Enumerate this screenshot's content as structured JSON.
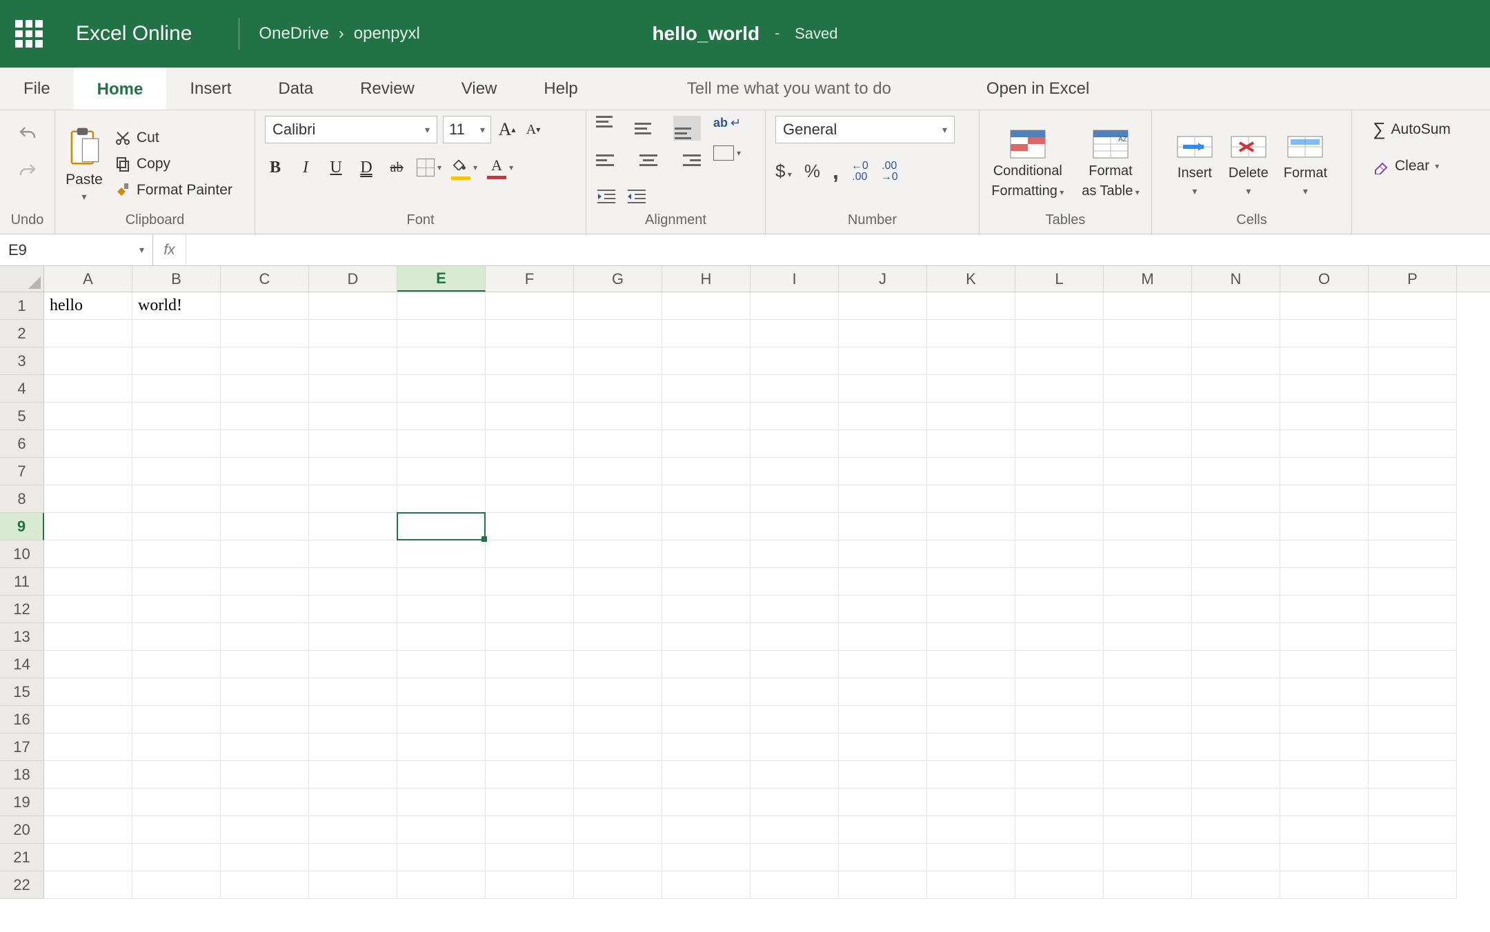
{
  "header": {
    "app_name": "Excel Online",
    "breadcrumb": [
      "OneDrive",
      "openpyxl"
    ],
    "doc_name": "hello_world",
    "doc_status": "Saved"
  },
  "tabs": {
    "items": [
      "File",
      "Home",
      "Insert",
      "Data",
      "Review",
      "View",
      "Help"
    ],
    "active": "Home",
    "tell_me": "Tell me what you want to do",
    "open_in_excel": "Open in Excel"
  },
  "ribbon": {
    "undo": {
      "label": "Undo"
    },
    "clipboard": {
      "paste": "Paste",
      "cut": "Cut",
      "copy": "Copy",
      "format_painter": "Format Painter",
      "label": "Clipboard"
    },
    "font": {
      "name": "Calibri",
      "size": "11",
      "grow": "A▴",
      "shrink": "A▾",
      "bold": "B",
      "italic": "I",
      "underline": "U",
      "dunder": "D",
      "strike": "ab",
      "label": "Font"
    },
    "alignment": {
      "wrap": "ab",
      "label": "Alignment"
    },
    "number": {
      "format": "General",
      "currency": "$",
      "percent": "%",
      "comma": ",",
      "inc": "←0\n.00",
      "dec": ".00\n→0",
      "label": "Number"
    },
    "tables": {
      "conditional": "Conditional",
      "conditional2": "Formatting",
      "formatas": "Format",
      "formatas2": "as Table",
      "label": "Tables"
    },
    "cells": {
      "insert": "Insert",
      "delete": "Delete",
      "format": "Format",
      "label": "Cells"
    },
    "editing": {
      "autosum": "AutoSum",
      "clear": "Clear"
    }
  },
  "namebox": {
    "ref": "E9"
  },
  "grid": {
    "columns": [
      "A",
      "B",
      "C",
      "D",
      "E",
      "F",
      "G",
      "H",
      "I",
      "J",
      "K",
      "L",
      "M",
      "N",
      "O",
      "P"
    ],
    "rows": 22,
    "active_col": "E",
    "active_row": 9,
    "cells": {
      "A1": "hello",
      "B1": "world!"
    }
  }
}
